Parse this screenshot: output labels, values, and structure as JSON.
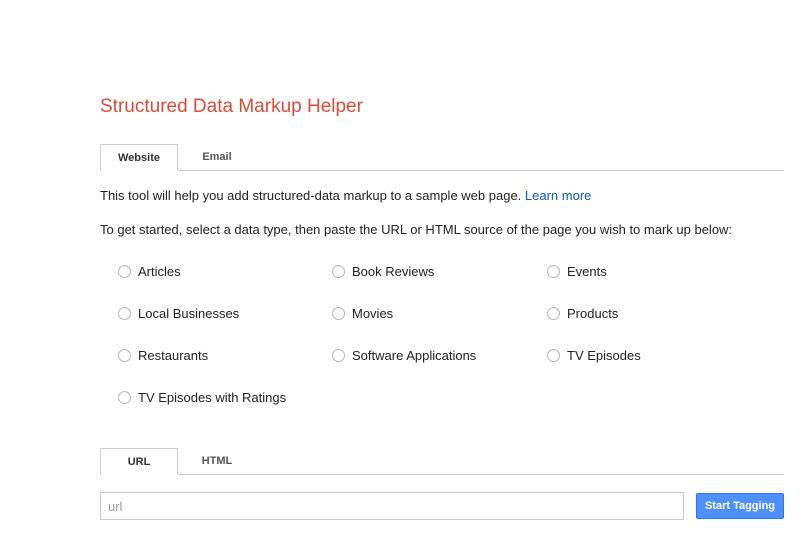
{
  "header": {
    "title": "Structured Data Markup Helper"
  },
  "source_tabs": [
    {
      "label": "Website",
      "active": true
    },
    {
      "label": "Email",
      "active": false
    }
  ],
  "intro": {
    "text": "This tool will help you add structured-data markup to a sample web page.",
    "link_label": "Learn more"
  },
  "instructions": "To get started, select a data type, then paste the URL or HTML source of the page you wish to mark up below:",
  "data_types": [
    {
      "label": "Articles",
      "selected": false
    },
    {
      "label": "Book Reviews",
      "selected": false
    },
    {
      "label": "Events",
      "selected": false
    },
    {
      "label": "Local Businesses",
      "selected": false
    },
    {
      "label": "Movies",
      "selected": false
    },
    {
      "label": "Products",
      "selected": false
    },
    {
      "label": "Restaurants",
      "selected": false
    },
    {
      "label": "Software Applications",
      "selected": false
    },
    {
      "label": "TV Episodes",
      "selected": false
    },
    {
      "label": "TV Episodes with Ratings",
      "selected": false
    }
  ],
  "input_tabs": [
    {
      "label": "URL",
      "active": true
    },
    {
      "label": "HTML",
      "active": false
    }
  ],
  "url_input": {
    "value": "",
    "placeholder": "url"
  },
  "start_button": {
    "label": "Start Tagging"
  },
  "colors": {
    "title": "#dd4b39",
    "link": "#1155cc",
    "button": "#4d90fe"
  }
}
